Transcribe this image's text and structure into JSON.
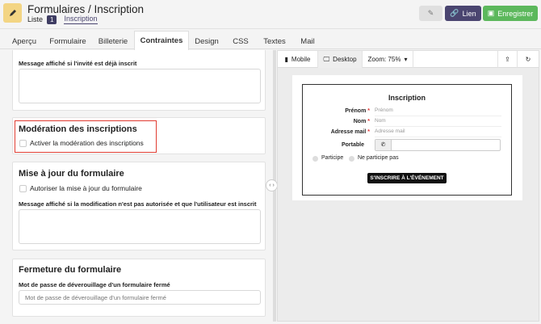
{
  "header": {
    "title": "Formulaires / Inscription",
    "crumb_list": "Liste",
    "crumb_count": "1",
    "crumb_current": "Inscription",
    "edit_icon": "edit-icon",
    "link_label": "Lien",
    "save_label": "Enregistrer"
  },
  "tabs": [
    "Aperçu",
    "Formulaire",
    "Billeterie",
    "Contraintes",
    "Design",
    "CSS",
    "Textes",
    "Mail"
  ],
  "left": {
    "already_label": "Message affiché si l'invité est déjà inscrit",
    "moderation_title": "Modération des inscriptions",
    "moderation_checkbox": "Activer la modération des inscriptions",
    "update_title": "Mise à jour du formulaire",
    "update_checkbox": "Autoriser la mise à jour du formulaire",
    "update_message_label": "Message affiché si la modification n'est pas autorisée et que l'utilisateur est inscrit",
    "close_title": "Fermeture du formulaire",
    "close_password_label": "Mot de passe de déverouillage d'un formulaire fermé",
    "close_password_placeholder": "Mot de passe de déverouillage d'un formulaire fermé"
  },
  "preview": {
    "mobile": "Mobile",
    "desktop": "Desktop",
    "zoom": "Zoom: 75%",
    "form_title": "Inscription",
    "fields": [
      {
        "label": "Prénom",
        "placeholder": "Prénom",
        "required": "*"
      },
      {
        "label": "Nom",
        "placeholder": "Nom",
        "required": "*"
      },
      {
        "label": "Adresse mail",
        "placeholder": "Adresse mail",
        "required": "*"
      }
    ],
    "phone_label": "Portable",
    "radio1": "Participe",
    "radio2": "Ne participe pas",
    "submit": "S'INSCRIRE À L'ÉVÉNEMENT"
  },
  "colors": {
    "accent": "#4a4570",
    "save": "#5cb85c",
    "highlight": "#e03c31",
    "logo": "#f3d584"
  }
}
